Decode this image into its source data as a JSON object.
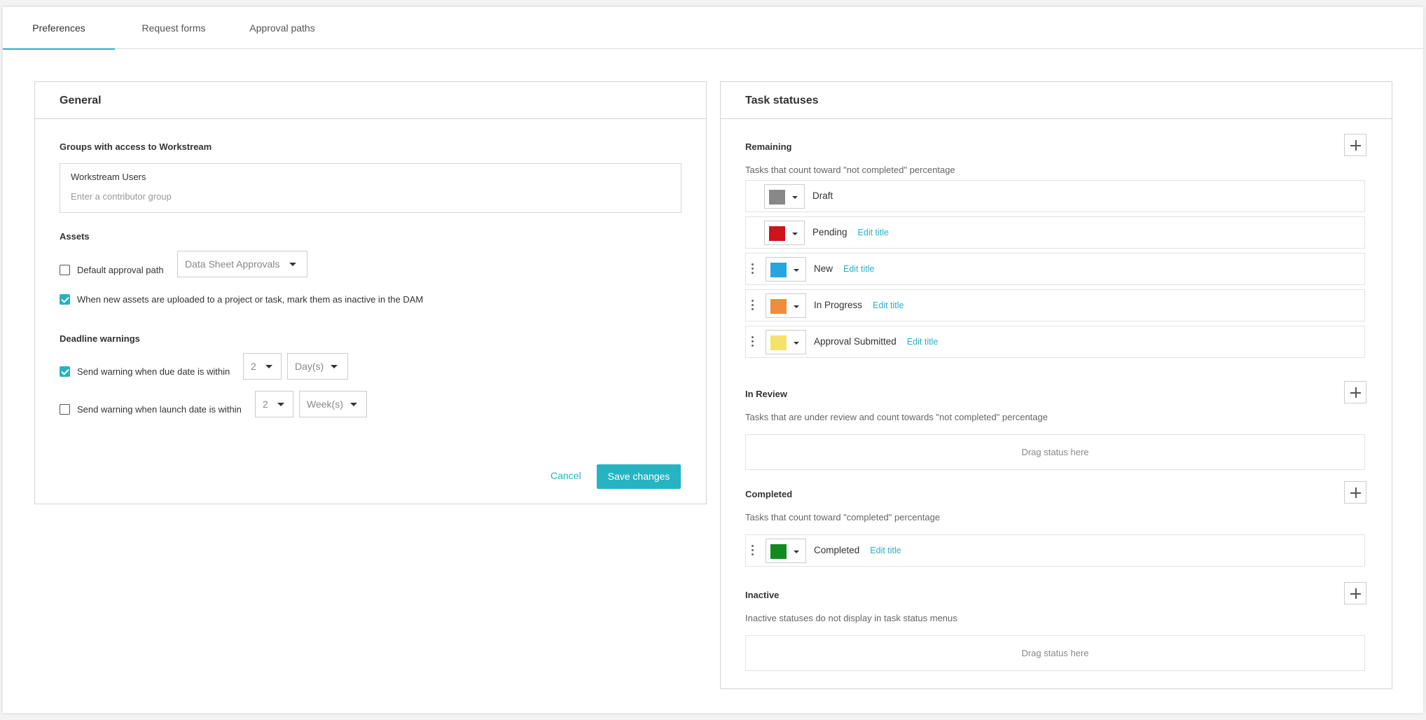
{
  "tabs": [
    {
      "label": "Preferences",
      "active": true
    },
    {
      "label": "Request forms",
      "active": false
    },
    {
      "label": "Approval paths",
      "active": false
    }
  ],
  "general": {
    "title": "General",
    "groups_title": "Groups with access to Workstream",
    "group_chip": "Workstream Users",
    "group_placeholder": "Enter a contributor group",
    "assets_title": "Assets",
    "default_approval_label": "Default approval path",
    "default_approval_checked": false,
    "default_approval_value": "Data Sheet Approvals",
    "inactive_label": "When new assets are uploaded to a project or task, mark them as inactive in the DAM",
    "inactive_checked": true,
    "deadline_title": "Deadline warnings",
    "due_label": "Send warning when due date is within",
    "due_checked": true,
    "due_number": "2",
    "due_unit": "Day(s)",
    "launch_label": "Send warning when launch date is within",
    "launch_checked": false,
    "launch_number": "2",
    "launch_unit": "Week(s)",
    "cancel_label": "Cancel",
    "save_label": "Save changes"
  },
  "task_statuses": {
    "title": "Task statuses",
    "edit_label": "Edit title",
    "drag_label": "Drag status here",
    "remaining": {
      "title": "Remaining",
      "description": "Tasks that count toward \"not completed\" percentage",
      "statuses": [
        {
          "name": "Draft",
          "color": "#888888",
          "draggable": false,
          "editable": false
        },
        {
          "name": "Pending",
          "color": "#d0121b",
          "draggable": false,
          "editable": true
        },
        {
          "name": "New",
          "color": "#25a6df",
          "draggable": true,
          "editable": true
        },
        {
          "name": "In Progress",
          "color": "#f08c3a",
          "draggable": true,
          "editable": true
        },
        {
          "name": "Approval Submitted",
          "color": "#f4e26a",
          "draggable": true,
          "editable": true
        }
      ]
    },
    "in_review": {
      "title": "In Review",
      "description": "Tasks that are under review and count towards \"not completed\" percentage"
    },
    "completed": {
      "title": "Completed",
      "description": "Tasks that count toward \"completed\" percentage",
      "statuses": [
        {
          "name": "Completed",
          "color": "#138a1e",
          "draggable": true,
          "editable": true
        }
      ]
    },
    "inactive": {
      "title": "Inactive",
      "description": "Inactive statuses do not display in task status menus"
    }
  },
  "colors": {
    "accent": "#26b3c2"
  }
}
